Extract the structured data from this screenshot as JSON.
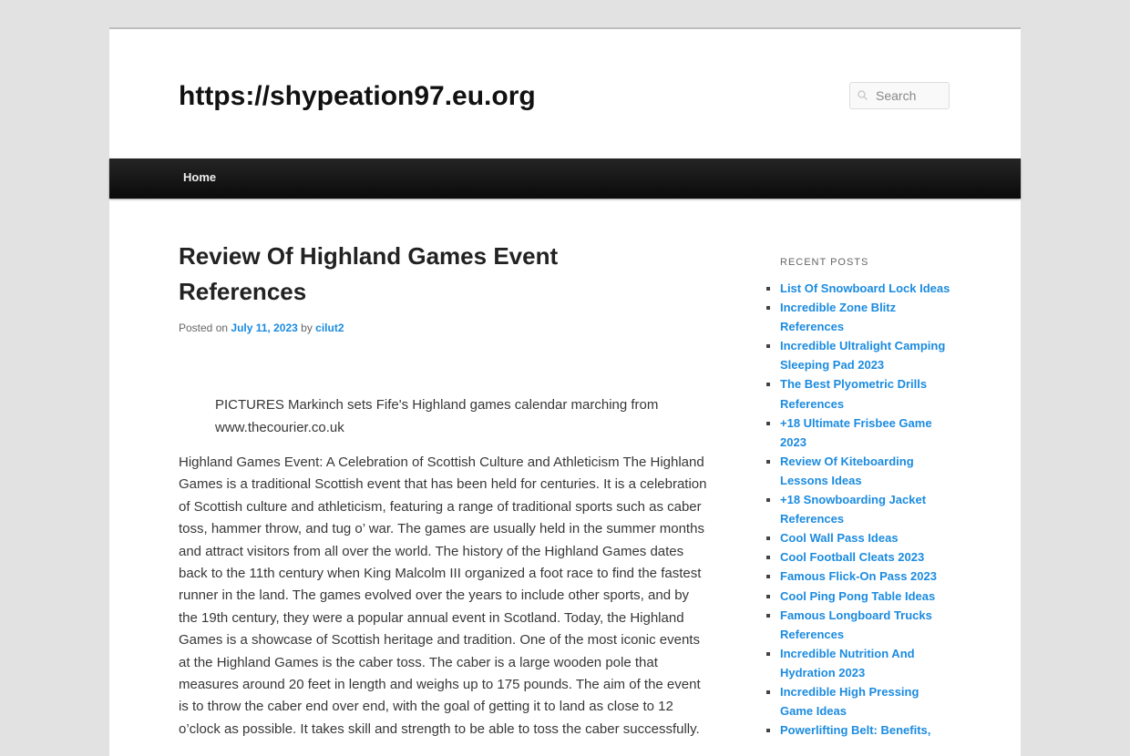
{
  "site": {
    "title": "https://shypeation97.eu.org"
  },
  "search": {
    "placeholder": "Search"
  },
  "nav": {
    "home_label": "Home"
  },
  "post": {
    "title": "Review Of Highland Games Event References",
    "posted_on_label": "Posted on",
    "date": "July 11, 2023",
    "by_label": "by",
    "author": "cilut2",
    "caption": "PICTURES Markinch sets Fife's Highland games calendar marching from www.thecourier.co.uk",
    "body": "Highland Games Event: A Celebration of Scottish Culture and Athleticism The Highland Games is a traditional Scottish event that has been held for centuries. It is a celebration of Scottish culture and athleticism, featuring a range of traditional sports such as caber toss, hammer throw, and tug o’ war. The games are usually held in the summer months and attract visitors from all over the world. The history of the Highland Games dates back to the 11th century when King Malcolm III organized a foot race to find the fastest runner in the land. The games evolved over the years to include other sports, and by the 19th century, they were a popular annual event in Scotland. Today, the Highland Games is a showcase of Scottish heritage and tradition. One of the most iconic events at the Highland Games is the caber toss. The caber is a large wooden pole that measures around 20 feet in length and weighs up to 175 pounds. The aim of the event is to throw the caber end over end, with the goal of getting it to land as close to 12 o’clock as possible. It takes skill and strength to be able to toss the caber successfully."
  },
  "sidebar": {
    "widget_title": "RECENT POSTS",
    "recent_posts": [
      "List Of Snowboard Lock Ideas",
      "Incredible Zone Blitz References",
      "Incredible Ultralight Camping Sleeping Pad 2023",
      "The Best Plyometric Drills References",
      "+18 Ultimate Frisbee Game 2023",
      "Review Of Kiteboarding Lessons Ideas",
      "+18 Snowboarding Jacket References",
      "Cool Wall Pass Ideas",
      "Cool Football Cleats 2023",
      "Famous Flick-On Pass 2023",
      "Cool Ping Pong Table Ideas",
      "Famous Longboard Trucks References",
      "Incredible Nutrition And Hydration 2023",
      "Incredible High Pressing Game Ideas",
      "Powerlifting Belt: Benefits,"
    ]
  },
  "colors": {
    "link": "#1b8be0",
    "nav_bar": "#111111",
    "page_bg": "#e2e2e2"
  }
}
